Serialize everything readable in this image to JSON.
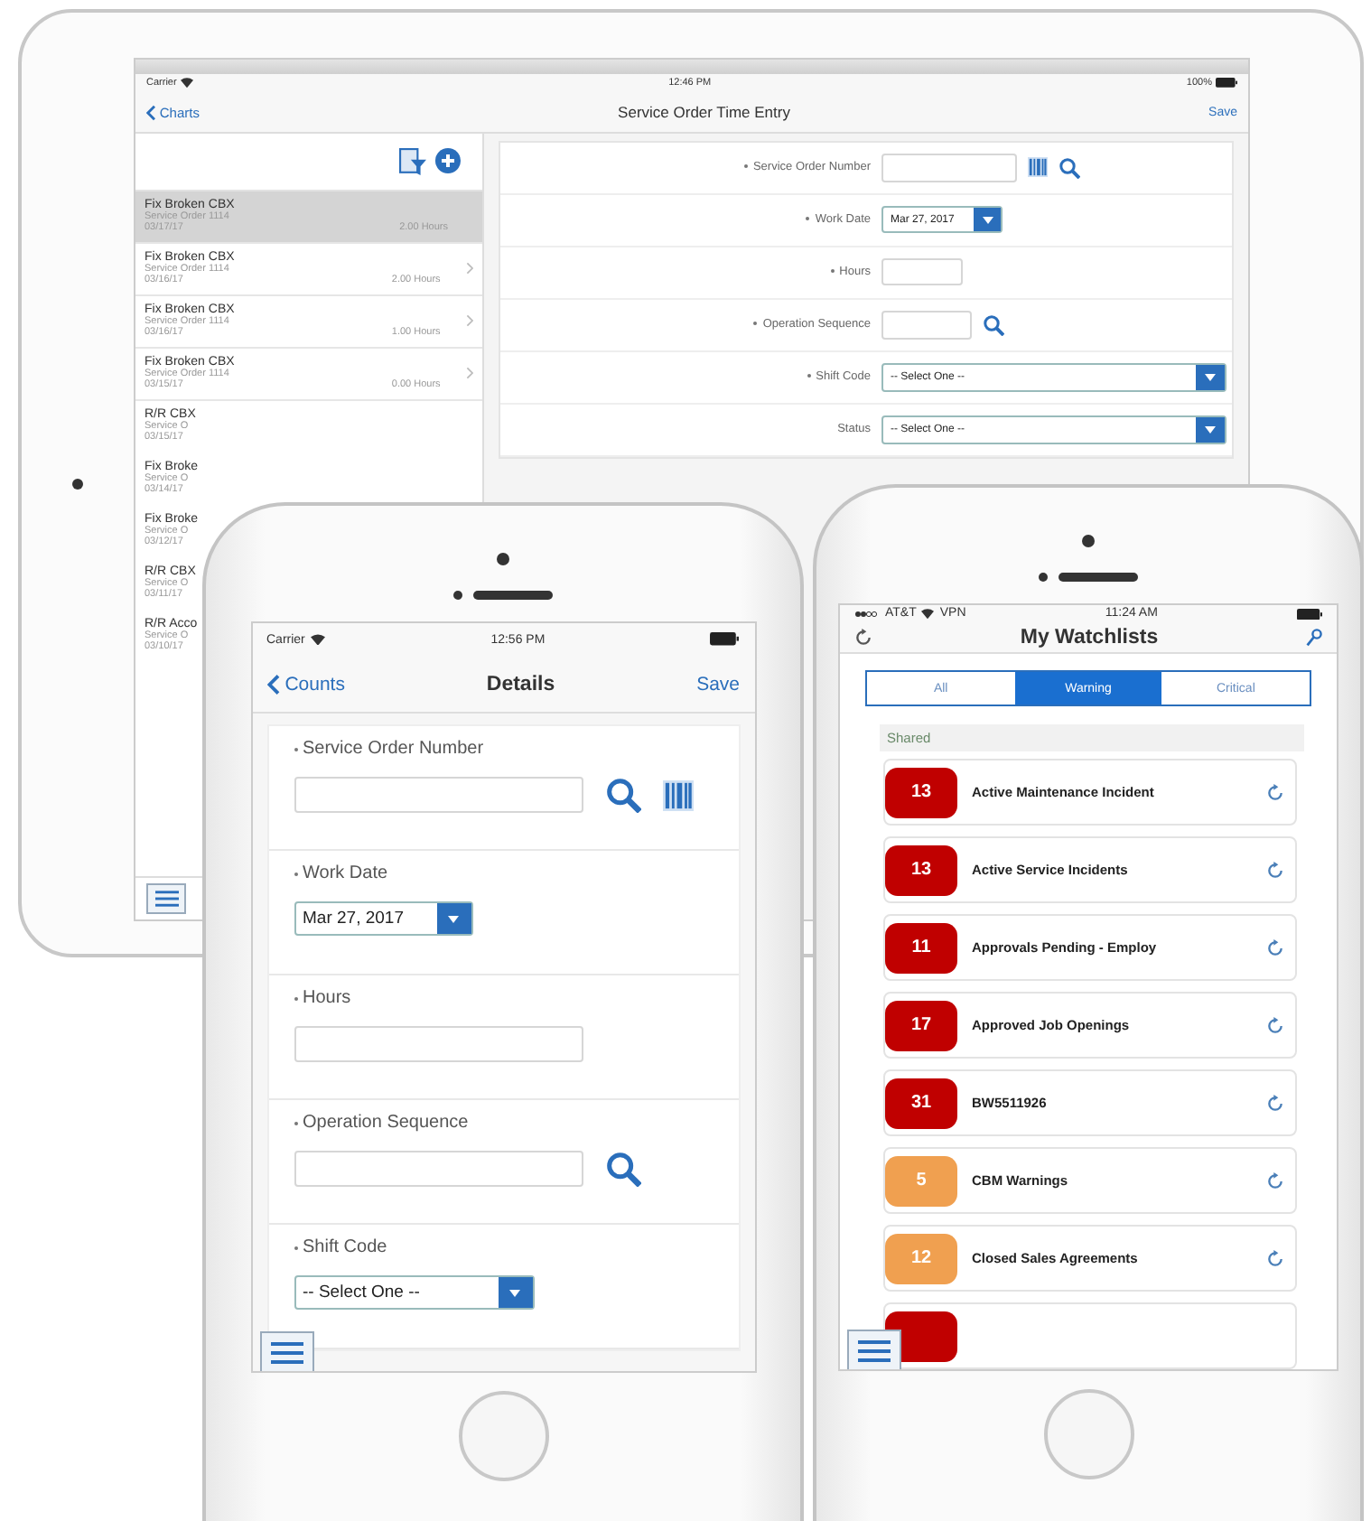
{
  "tablet": {
    "status": {
      "carrier": "Carrier",
      "time": "12:46 PM",
      "battery": "100%"
    },
    "nav": {
      "back": "Charts",
      "title": "Service Order Time Entry",
      "action": "Save"
    },
    "list": [
      {
        "title": "Fix Broken CBX",
        "subtitle": "Service Order 1114",
        "date": "03/17/17",
        "hours": "2.00 Hours",
        "selected": true
      },
      {
        "title": "Fix Broken CBX",
        "subtitle": "Service Order 1114",
        "date": "03/16/17",
        "hours": "2.00 Hours",
        "selected": false
      },
      {
        "title": "Fix Broken CBX",
        "subtitle": "Service Order 1114",
        "date": "03/16/17",
        "hours": "1.00 Hours",
        "selected": false
      },
      {
        "title": "Fix Broken CBX",
        "subtitle": "Service Order 1114",
        "date": "03/15/17",
        "hours": "0.00 Hours",
        "selected": false
      },
      {
        "title": "R/R CBX",
        "subtitle": "Service O",
        "date": "03/15/17",
        "selected": false
      },
      {
        "title": "Fix Broke",
        "subtitle": "Service O",
        "date": "03/14/17",
        "selected": false
      },
      {
        "title": "Fix Broke",
        "subtitle": "Service O",
        "date": "03/12/17",
        "selected": false
      },
      {
        "title": "R/R CBX",
        "subtitle": "Service O",
        "date": "03/11/17",
        "selected": false
      },
      {
        "title": "R/R Acco",
        "subtitle": "Service O",
        "date": "03/10/17",
        "selected": false
      }
    ],
    "form": [
      {
        "kind": "scan_lookup",
        "label": "Service Order Number",
        "required": true
      },
      {
        "kind": "date",
        "label": "Work Date",
        "value": "Mar 27, 2017",
        "required": true
      },
      {
        "kind": "text",
        "label": "Hours",
        "required": true
      },
      {
        "kind": "lookup",
        "label": "Operation Sequence",
        "required": true
      },
      {
        "kind": "select",
        "label": "Shift Code",
        "value": "-- Select One --",
        "required": true
      },
      {
        "kind": "select",
        "label": "Status",
        "value": "-- Select One --",
        "required": false
      }
    ]
  },
  "details_phone": {
    "status": {
      "carrier": "Carrier",
      "time": "12:56 PM"
    },
    "nav": {
      "back": "Counts",
      "title": "Details",
      "action": "Save"
    },
    "form": [
      {
        "kind": "scan_lookup",
        "label": "Service Order Number",
        "required": true
      },
      {
        "kind": "date",
        "label": "Work Date",
        "value": "Mar 27, 2017",
        "required": true
      },
      {
        "kind": "text",
        "label": "Hours",
        "required": true
      },
      {
        "kind": "lookup",
        "label": "Operation Sequence",
        "required": true
      },
      {
        "kind": "select",
        "label": "Shift Code",
        "value": "-- Select One --",
        "required": true
      }
    ]
  },
  "watchlist_phone": {
    "status": {
      "carrier": "AT&T",
      "network": "VPN",
      "time": "11:24 AM"
    },
    "nav": {
      "title": "My Watchlists"
    },
    "segments": [
      {
        "label": "All",
        "selected": false
      },
      {
        "label": "Warning",
        "selected": true
      },
      {
        "label": "Critical",
        "selected": false
      }
    ],
    "section": "Shared",
    "items": [
      {
        "count": "13",
        "name": "Active Maintenance Incident",
        "color": "#c00000"
      },
      {
        "count": "13",
        "name": "Active Service Incidents",
        "color": "#c00000"
      },
      {
        "count": "11",
        "name": "Approvals Pending - Employ",
        "color": "#c00000"
      },
      {
        "count": "17",
        "name": "Approved Job Openings",
        "color": "#c00000"
      },
      {
        "count": "31",
        "name": "BW5511926",
        "color": "#c00000"
      },
      {
        "count": "5",
        "name": "CBM Warnings",
        "color": "#f0a050"
      },
      {
        "count": "12",
        "name": "Closed Sales Agreements",
        "color": "#f0a050"
      },
      {
        "color": "#c00000"
      }
    ]
  }
}
